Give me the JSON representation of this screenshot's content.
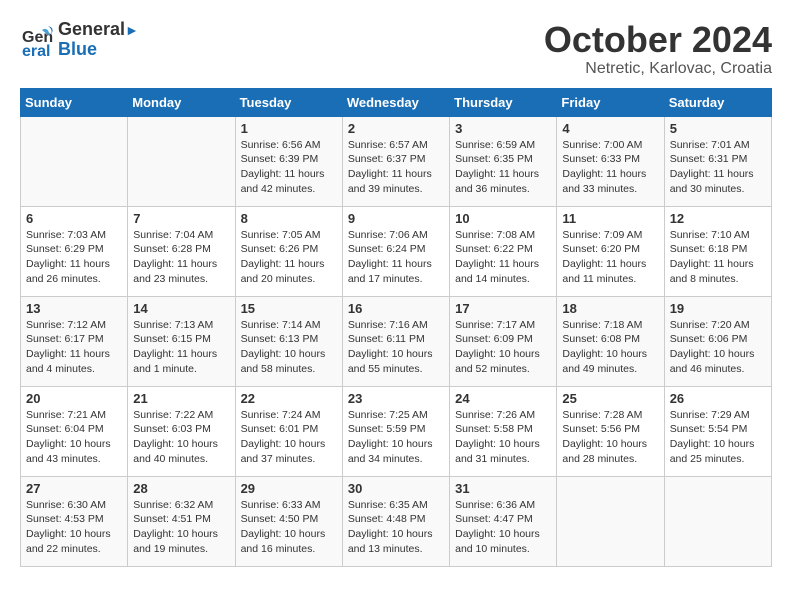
{
  "logo": {
    "line1": "General",
    "line2": "Blue"
  },
  "title": "October 2024",
  "subtitle": "Netretic, Karlovac, Croatia",
  "weekdays": [
    "Sunday",
    "Monday",
    "Tuesday",
    "Wednesday",
    "Thursday",
    "Friday",
    "Saturday"
  ],
  "weeks": [
    [
      {
        "day": "",
        "info": ""
      },
      {
        "day": "",
        "info": ""
      },
      {
        "day": "1",
        "info": "Sunrise: 6:56 AM\nSunset: 6:39 PM\nDaylight: 11 hours and 42 minutes."
      },
      {
        "day": "2",
        "info": "Sunrise: 6:57 AM\nSunset: 6:37 PM\nDaylight: 11 hours and 39 minutes."
      },
      {
        "day": "3",
        "info": "Sunrise: 6:59 AM\nSunset: 6:35 PM\nDaylight: 11 hours and 36 minutes."
      },
      {
        "day": "4",
        "info": "Sunrise: 7:00 AM\nSunset: 6:33 PM\nDaylight: 11 hours and 33 minutes."
      },
      {
        "day": "5",
        "info": "Sunrise: 7:01 AM\nSunset: 6:31 PM\nDaylight: 11 hours and 30 minutes."
      }
    ],
    [
      {
        "day": "6",
        "info": "Sunrise: 7:03 AM\nSunset: 6:29 PM\nDaylight: 11 hours and 26 minutes."
      },
      {
        "day": "7",
        "info": "Sunrise: 7:04 AM\nSunset: 6:28 PM\nDaylight: 11 hours and 23 minutes."
      },
      {
        "day": "8",
        "info": "Sunrise: 7:05 AM\nSunset: 6:26 PM\nDaylight: 11 hours and 20 minutes."
      },
      {
        "day": "9",
        "info": "Sunrise: 7:06 AM\nSunset: 6:24 PM\nDaylight: 11 hours and 17 minutes."
      },
      {
        "day": "10",
        "info": "Sunrise: 7:08 AM\nSunset: 6:22 PM\nDaylight: 11 hours and 14 minutes."
      },
      {
        "day": "11",
        "info": "Sunrise: 7:09 AM\nSunset: 6:20 PM\nDaylight: 11 hours and 11 minutes."
      },
      {
        "day": "12",
        "info": "Sunrise: 7:10 AM\nSunset: 6:18 PM\nDaylight: 11 hours and 8 minutes."
      }
    ],
    [
      {
        "day": "13",
        "info": "Sunrise: 7:12 AM\nSunset: 6:17 PM\nDaylight: 11 hours and 4 minutes."
      },
      {
        "day": "14",
        "info": "Sunrise: 7:13 AM\nSunset: 6:15 PM\nDaylight: 11 hours and 1 minute."
      },
      {
        "day": "15",
        "info": "Sunrise: 7:14 AM\nSunset: 6:13 PM\nDaylight: 10 hours and 58 minutes."
      },
      {
        "day": "16",
        "info": "Sunrise: 7:16 AM\nSunset: 6:11 PM\nDaylight: 10 hours and 55 minutes."
      },
      {
        "day": "17",
        "info": "Sunrise: 7:17 AM\nSunset: 6:09 PM\nDaylight: 10 hours and 52 minutes."
      },
      {
        "day": "18",
        "info": "Sunrise: 7:18 AM\nSunset: 6:08 PM\nDaylight: 10 hours and 49 minutes."
      },
      {
        "day": "19",
        "info": "Sunrise: 7:20 AM\nSunset: 6:06 PM\nDaylight: 10 hours and 46 minutes."
      }
    ],
    [
      {
        "day": "20",
        "info": "Sunrise: 7:21 AM\nSunset: 6:04 PM\nDaylight: 10 hours and 43 minutes."
      },
      {
        "day": "21",
        "info": "Sunrise: 7:22 AM\nSunset: 6:03 PM\nDaylight: 10 hours and 40 minutes."
      },
      {
        "day": "22",
        "info": "Sunrise: 7:24 AM\nSunset: 6:01 PM\nDaylight: 10 hours and 37 minutes."
      },
      {
        "day": "23",
        "info": "Sunrise: 7:25 AM\nSunset: 5:59 PM\nDaylight: 10 hours and 34 minutes."
      },
      {
        "day": "24",
        "info": "Sunrise: 7:26 AM\nSunset: 5:58 PM\nDaylight: 10 hours and 31 minutes."
      },
      {
        "day": "25",
        "info": "Sunrise: 7:28 AM\nSunset: 5:56 PM\nDaylight: 10 hours and 28 minutes."
      },
      {
        "day": "26",
        "info": "Sunrise: 7:29 AM\nSunset: 5:54 PM\nDaylight: 10 hours and 25 minutes."
      }
    ],
    [
      {
        "day": "27",
        "info": "Sunrise: 6:30 AM\nSunset: 4:53 PM\nDaylight: 10 hours and 22 minutes."
      },
      {
        "day": "28",
        "info": "Sunrise: 6:32 AM\nSunset: 4:51 PM\nDaylight: 10 hours and 19 minutes."
      },
      {
        "day": "29",
        "info": "Sunrise: 6:33 AM\nSunset: 4:50 PM\nDaylight: 10 hours and 16 minutes."
      },
      {
        "day": "30",
        "info": "Sunrise: 6:35 AM\nSunset: 4:48 PM\nDaylight: 10 hours and 13 minutes."
      },
      {
        "day": "31",
        "info": "Sunrise: 6:36 AM\nSunset: 4:47 PM\nDaylight: 10 hours and 10 minutes."
      },
      {
        "day": "",
        "info": ""
      },
      {
        "day": "",
        "info": ""
      }
    ]
  ]
}
